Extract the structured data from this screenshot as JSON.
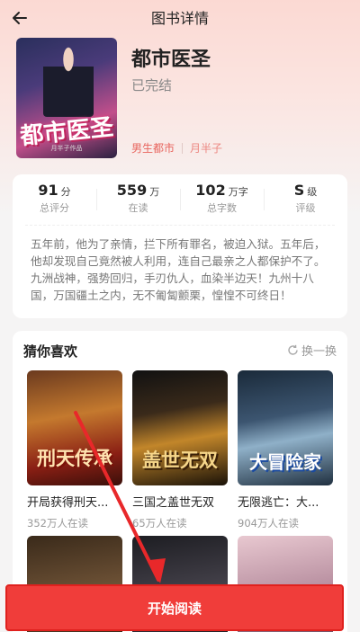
{
  "header": {
    "title": "图书详情"
  },
  "book": {
    "cover_text": "都市医圣",
    "cover_small": "月半子作品",
    "title": "都市医圣",
    "status": "已完结",
    "genre": "男生都市",
    "author": "月半子"
  },
  "stats": [
    {
      "value": "91",
      "unit": "分",
      "label": "总评分"
    },
    {
      "value": "559",
      "unit": "万",
      "label": "在读"
    },
    {
      "value": "102",
      "unit": "万字",
      "label": "总字数"
    },
    {
      "value": "S",
      "unit": "级",
      "label": "评级"
    }
  ],
  "description": "五年前，他为了亲情，拦下所有罪名，被迫入狱。五年后，他却发现自己竟然被人利用，连自己最亲之人都保护不了。九洲战神，强势回归，手刃仇人，血染半边天！九州十八国，万国疆土之内，无不匍匐颤栗，惶惶不可终日！",
  "recommend": {
    "title": "猜你喜欢",
    "refresh": "换一换",
    "books": [
      {
        "name": "开局获得刑天...",
        "readers": "352万人在读",
        "art": "刑天传承"
      },
      {
        "name": "三国之盖世无双",
        "readers": "65万人在读",
        "art": "盖世无双"
      },
      {
        "name": "无限逃亡：大...",
        "readers": "904万人在读",
        "art": "大冒险家"
      }
    ]
  },
  "start_button": "开始阅读",
  "colors": {
    "accent": "#f03d3a",
    "tag": "#e8655e"
  }
}
